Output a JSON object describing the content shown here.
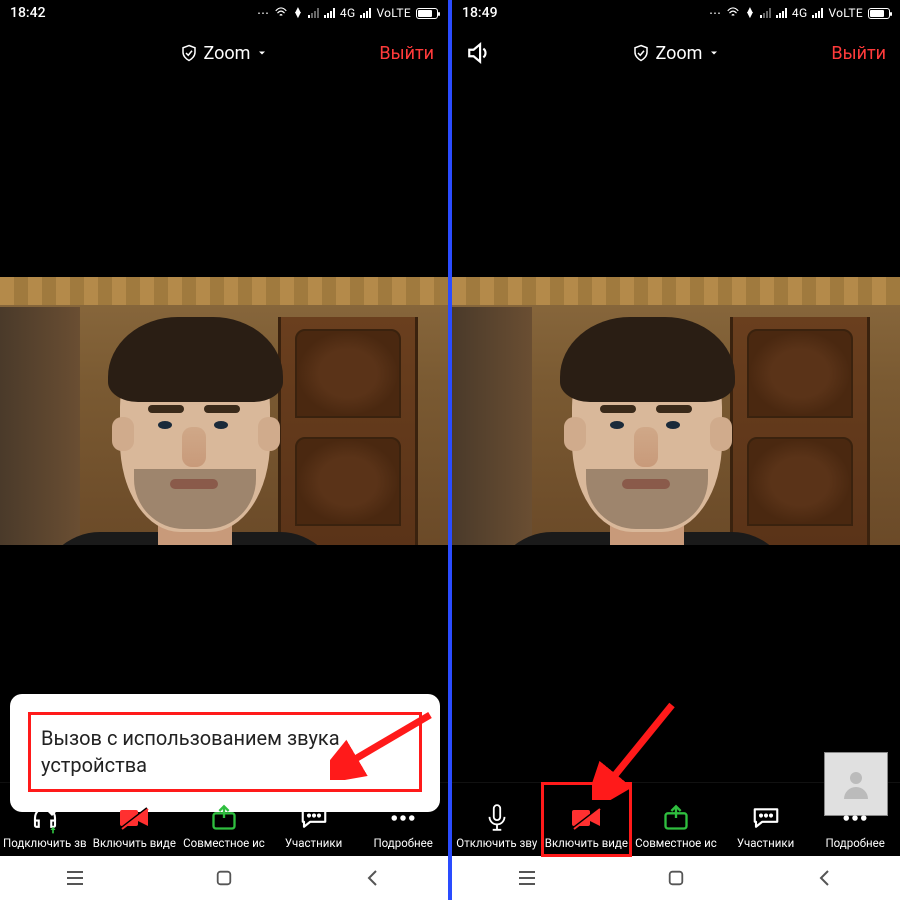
{
  "left": {
    "status": {
      "time": "18:42",
      "net1": "4G",
      "net2": "VoLTE"
    },
    "top": {
      "title": "Zoom",
      "leave": "Выйти"
    },
    "popup": {
      "text": "Вызов с использованием звука устройства"
    },
    "bottom": {
      "items": [
        {
          "label": "Подключить зв",
          "icon": "headset"
        },
        {
          "label": "Включить виде",
          "icon": "video-off"
        },
        {
          "label": "Совместное ис",
          "icon": "share"
        },
        {
          "label": "Участники",
          "icon": "chat"
        },
        {
          "label": "Подробнее",
          "icon": "more"
        }
      ]
    }
  },
  "right": {
    "status": {
      "time": "18:49",
      "net1": "4G",
      "net2": "VoLTE"
    },
    "top": {
      "title": "Zoom",
      "leave": "Выйти"
    },
    "bottom": {
      "items": [
        {
          "label": "Отключить зву",
          "icon": "mic"
        },
        {
          "label": "Включить виде",
          "icon": "video-off"
        },
        {
          "label": "Совместное ис",
          "icon": "share"
        },
        {
          "label": "Участники",
          "icon": "chat"
        },
        {
          "label": "Подробнее",
          "icon": "more"
        }
      ]
    }
  }
}
